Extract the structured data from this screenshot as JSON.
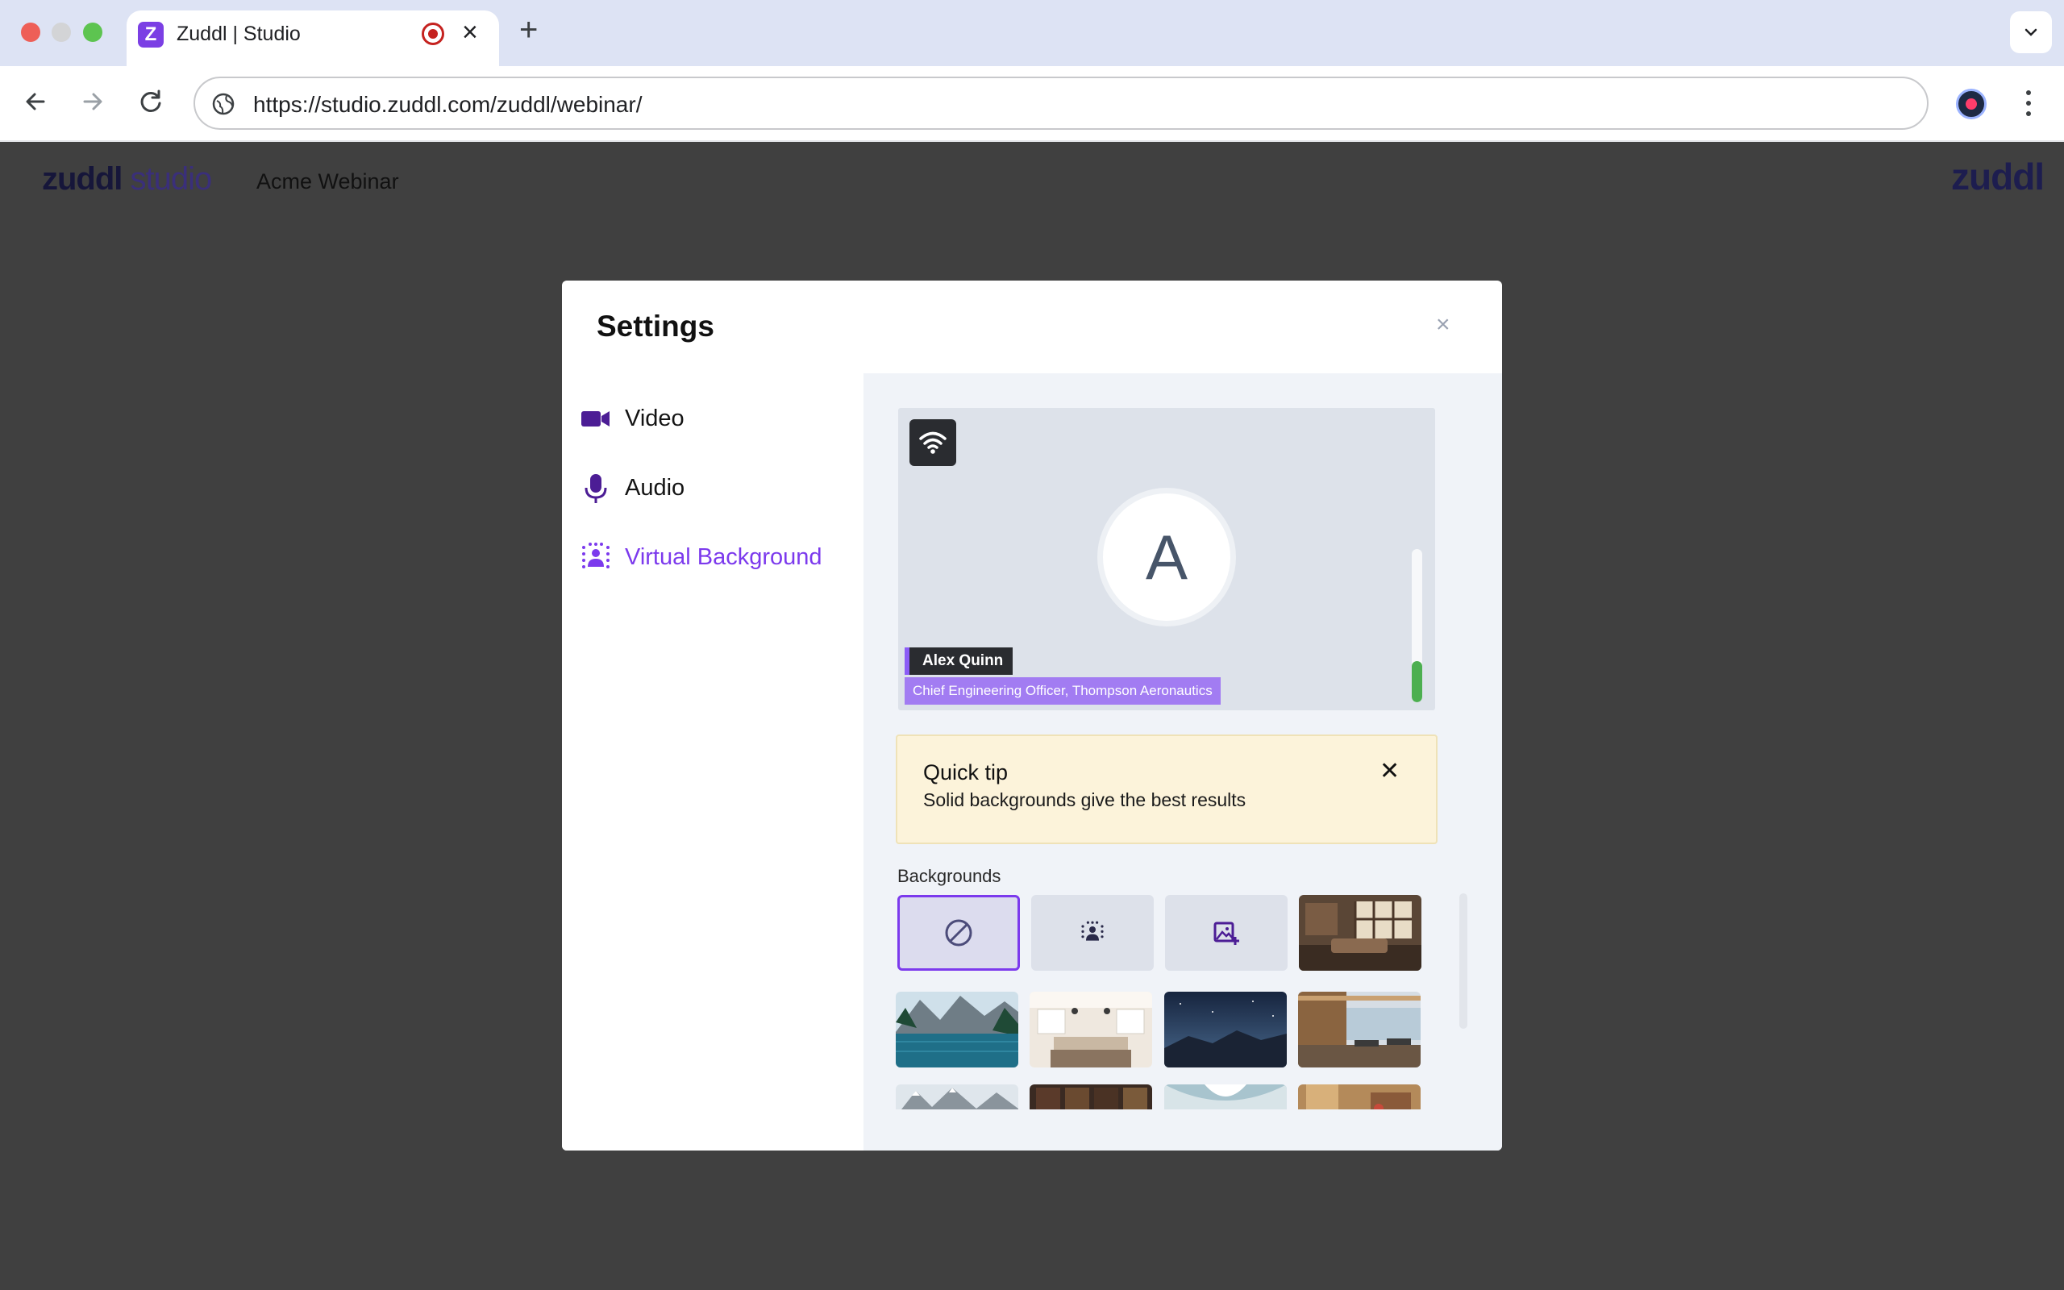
{
  "browser": {
    "tab_title": "Zuddl | Studio",
    "favicon_letter": "Z",
    "url": "https://studio.zuddl.com/zuddl/webinar/"
  },
  "app": {
    "logo_bold": "zuddl",
    "logo_light": "studio",
    "event_name": "Acme Webinar",
    "brand_mark": "zuddl"
  },
  "modal": {
    "title": "Settings",
    "close_glyph": "×",
    "sidebar": [
      {
        "label": "Video",
        "icon": "video-camera-icon"
      },
      {
        "label": "Audio",
        "icon": "microphone-icon"
      },
      {
        "label": "Virtual Background",
        "icon": "virtual-background-icon",
        "active": true
      }
    ],
    "preview": {
      "avatar_letter": "A",
      "name": "Alex Quinn",
      "title": "Chief Engineering Officer, Thompson Aeronautics",
      "audio_level": 0.27
    },
    "tip": {
      "title": "Quick tip",
      "text": "Solid backgrounds give the best results",
      "close_glyph": "✕"
    },
    "backgrounds": {
      "label": "Backgrounds",
      "options": [
        "none",
        "blur",
        "upload"
      ]
    }
  },
  "colors": {
    "accent": "#7c3aed",
    "level_green": "#4caf50",
    "tip_bg": "#fcf3da"
  }
}
